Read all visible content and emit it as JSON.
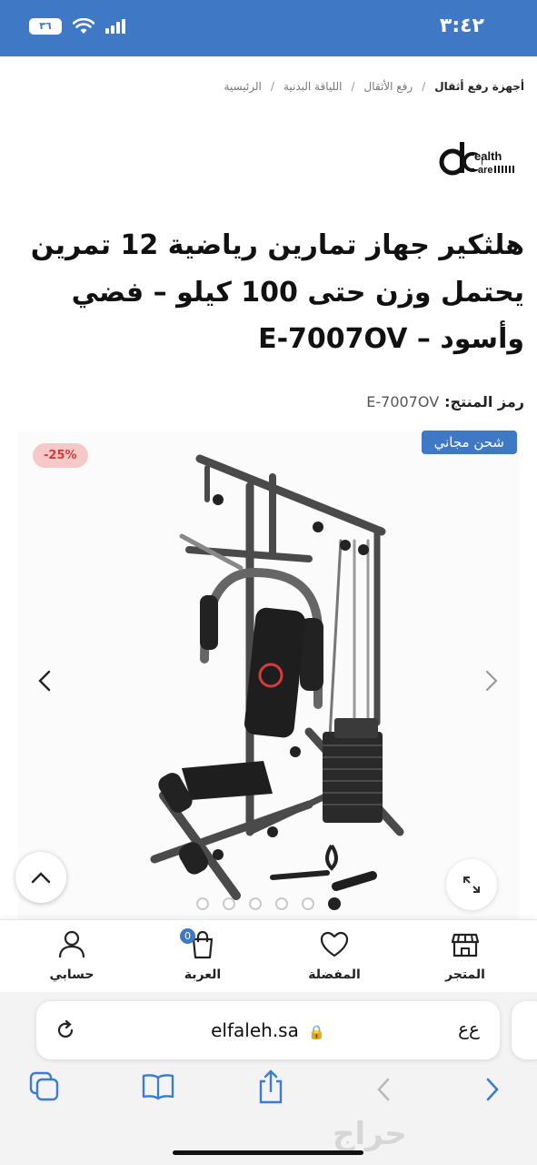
{
  "status_bar": {
    "time": "٣:٤٢",
    "battery": "٣٦"
  },
  "breadcrumb": [
    "الرئيسية",
    "اللياقة البدنية",
    "رفع الأثقال",
    "أجهزة رفع أثقال"
  ],
  "breadcrumb_separator": "/",
  "brand": {
    "logo_text_top": "ealth",
    "logo_text_bottom": "are"
  },
  "product": {
    "title": "هلثكير جهاز تمارين رياضية 12 تمرين يحتمل وزن حتى 100 كيلو – فضي وأسود – E-7007OV",
    "sku_label": "رمز المنتج:",
    "sku_value": "E-7007OV"
  },
  "gallery": {
    "shipping_badge": "شحن مجاني",
    "discount_badge": "-25%",
    "slide_count": 6,
    "active_slide": 6
  },
  "bottom_nav": [
    {
      "label": "المتجر",
      "icon": "store-icon"
    },
    {
      "label": "المفضلة",
      "icon": "heart-icon"
    },
    {
      "label": "العربة",
      "icon": "cart-icon",
      "count": "0"
    },
    {
      "label": "حسابي",
      "icon": "user-icon"
    }
  ],
  "browser": {
    "url": "elfaleh.sa",
    "aa_label": "ﻉﻉ"
  },
  "watermark": "حراج",
  "colors": {
    "primary": "#3f78c4",
    "discount_bg": "#f7c8c8",
    "discount_text": "#d63b3b"
  }
}
